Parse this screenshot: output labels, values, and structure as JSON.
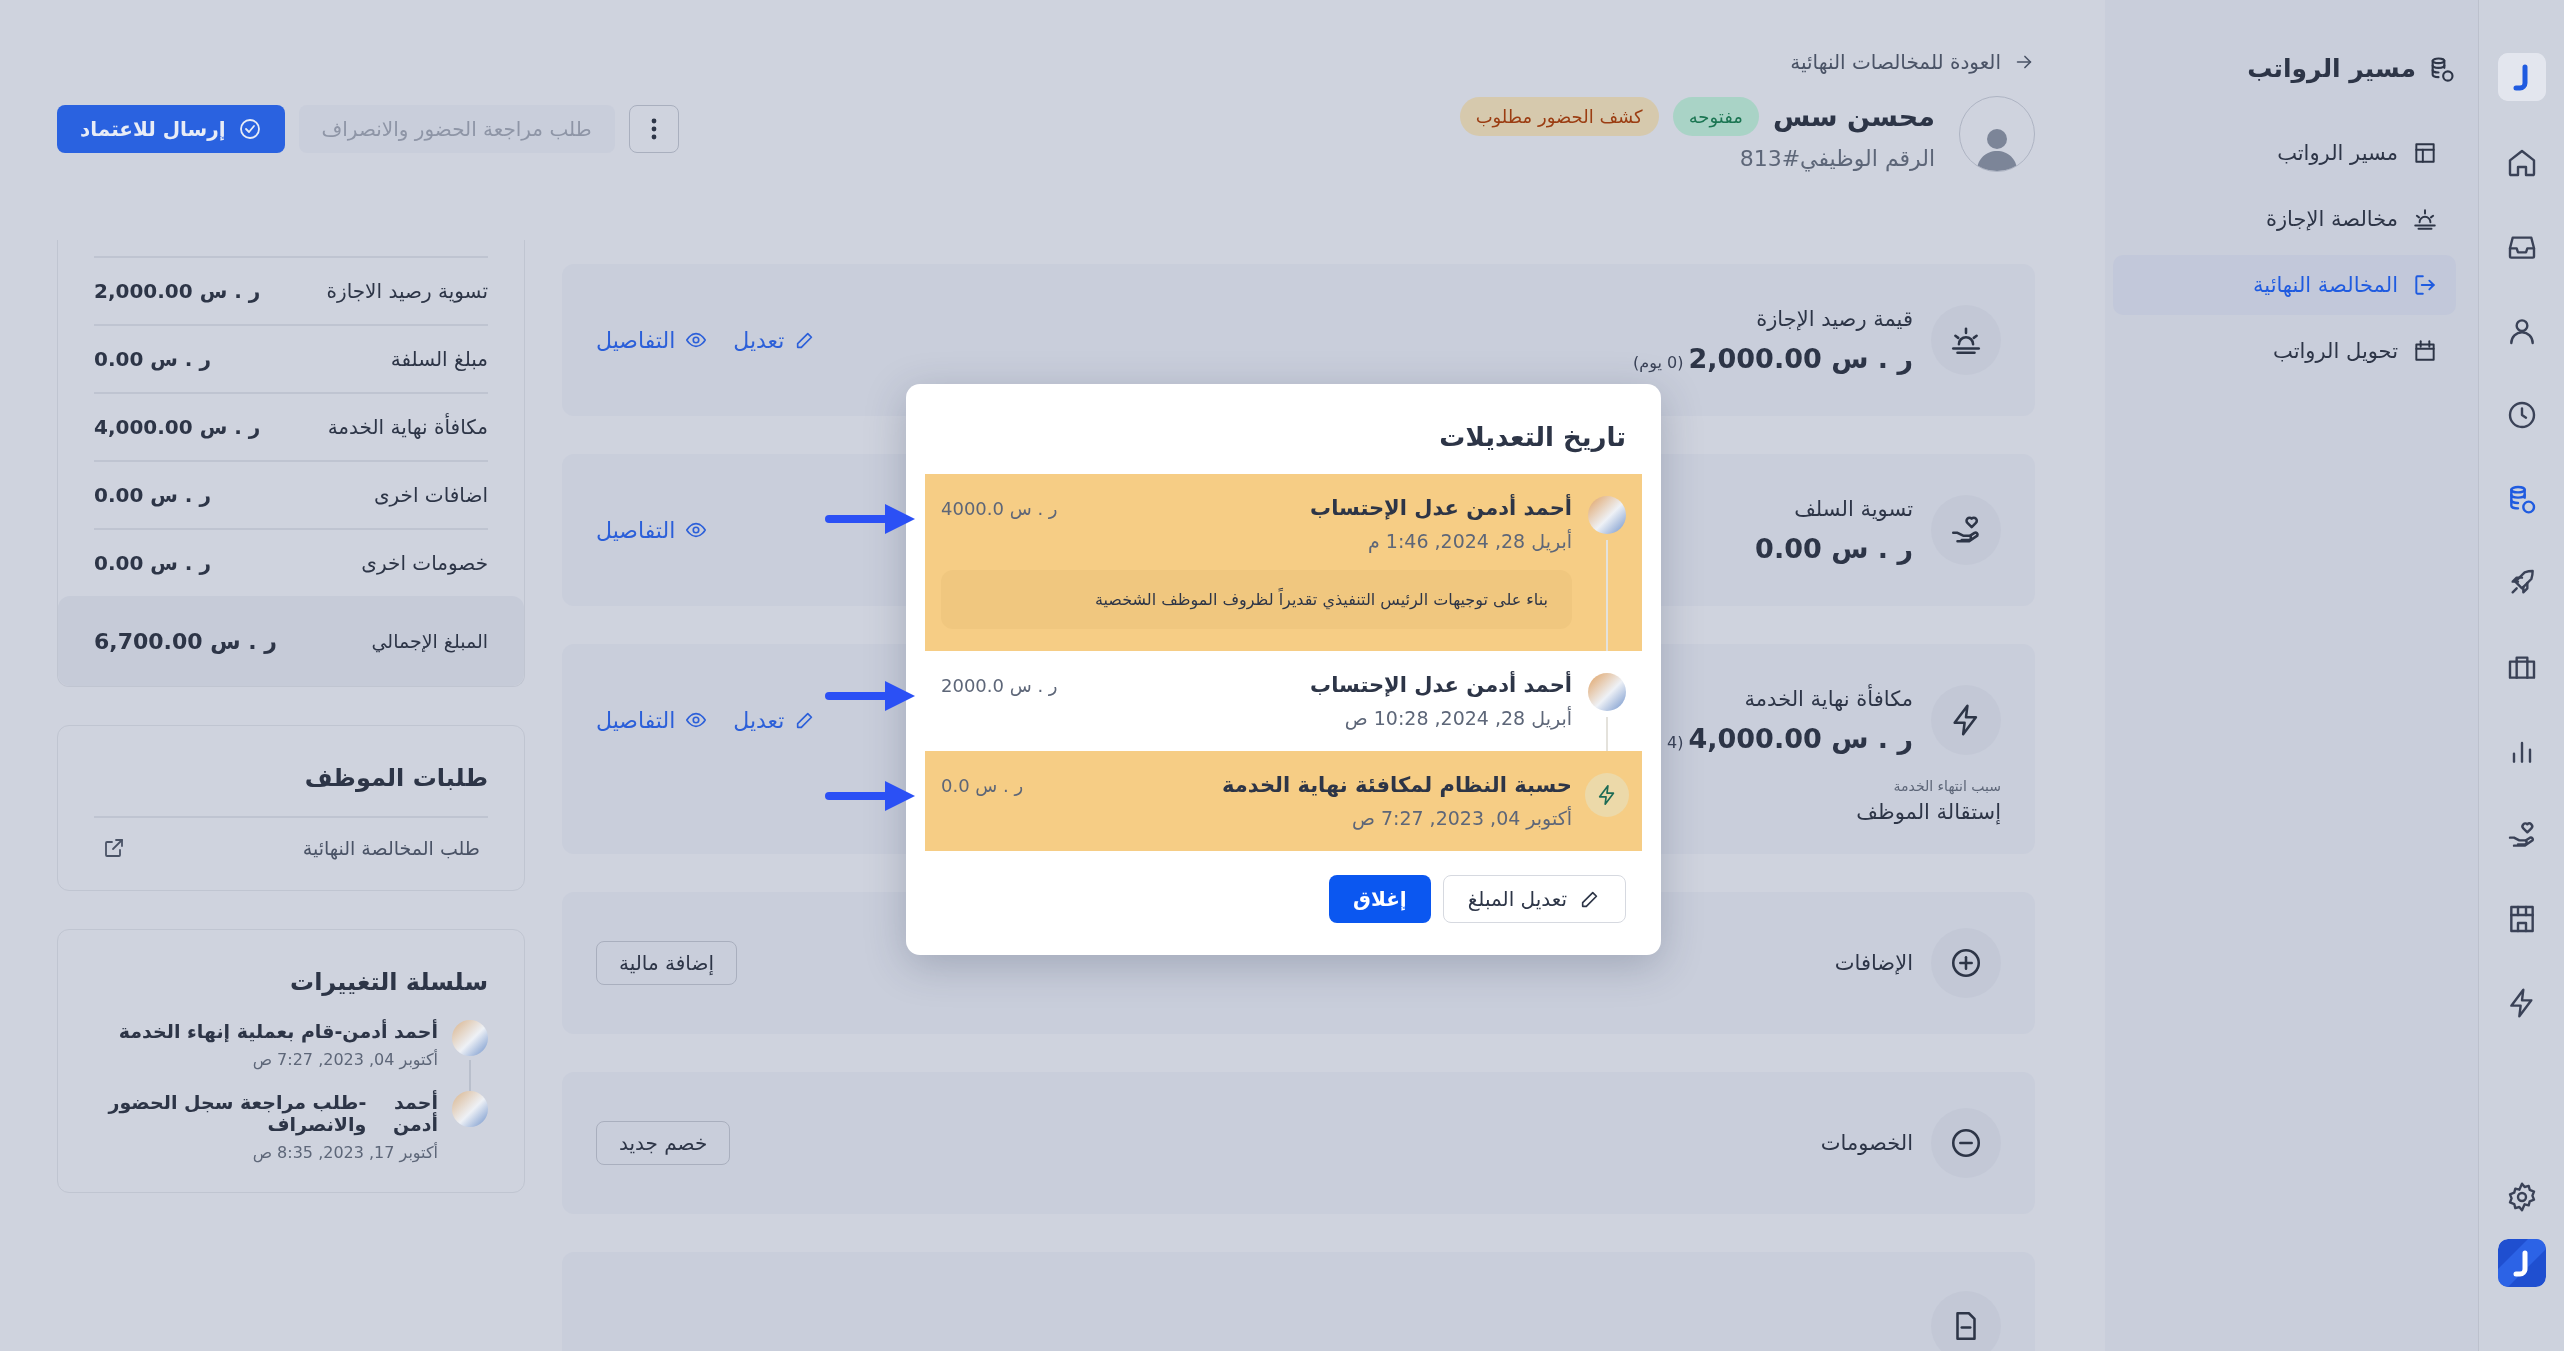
{
  "rail": {
    "items": [
      {
        "selected": false
      },
      {
        "selected": false
      },
      {
        "selected": false
      },
      {
        "selected": false
      },
      {
        "selected": true
      },
      {
        "selected": false
      },
      {
        "selected": false
      },
      {
        "selected": false
      },
      {
        "selected": false
      },
      {
        "selected": false
      },
      {
        "selected": false
      }
    ]
  },
  "sidebar": {
    "title": "مسير الرواتب",
    "items": [
      {
        "label": "مسير الرواتب",
        "selected": false
      },
      {
        "label": "مخالصة الإجازة",
        "selected": false
      },
      {
        "label": "المخالصة النهائية",
        "selected": true
      },
      {
        "label": "تحويل الرواتب",
        "selected": false
      }
    ]
  },
  "header": {
    "back_link": "العودة للمخالصات النهائية",
    "employee_name": "محسن سس",
    "badges": [
      {
        "label": "مفتوحه",
        "kind": "success"
      },
      {
        "label": "كشف الحضور مطلوب",
        "kind": "warning"
      }
    ],
    "employee_number": "الرقم الوظيفي#813"
  },
  "actions": [
    {
      "kind": "more",
      "disabled": false
    },
    {
      "kind": "secondary",
      "label": "طلب مراجعة الحضور والانصراف",
      "disabled": true
    },
    {
      "kind": "primary",
      "label": "إرسال للاعتماد",
      "disabled": false
    }
  ],
  "cards": [
    {
      "kind": "amount",
      "title": "قيمة رصيد الإجازة",
      "amount": "2,000.00 ر . س",
      "amount_note": "(0 يوم)",
      "links": [
        {
          "kind": "edit",
          "label": "تعديل"
        },
        {
          "kind": "details",
          "label": "التفاصيل"
        }
      ]
    },
    {
      "kind": "amount",
      "title": "تسوية السلف",
      "amount": "0.00 ر . س",
      "links": [
        {
          "kind": "details",
          "label": "التفاصيل"
        }
      ]
    },
    {
      "kind": "amount",
      "title": "مكافأة نهاية الخدمة",
      "amount": "4,000.00 ر . س",
      "amount_note": "(4",
      "reason_label": "سبب انتهاء الخدمة",
      "reason": "إستقالة الموظف",
      "links": [
        {
          "kind": "edit",
          "label": "تعديل"
        },
        {
          "kind": "details",
          "label": "التفاصيل"
        }
      ]
    },
    {
      "kind": "section",
      "title": "الإضافات",
      "button": "إضافة مالية"
    },
    {
      "kind": "section",
      "title": "الخصومات",
      "button": "خصم جديد"
    },
    {
      "kind": "cut"
    }
  ],
  "summary": {
    "rows": [
      {
        "label": "تسوية رصيد الاجازة",
        "value": "2,000.00 ر . س"
      },
      {
        "label": "مبلغ السلفة",
        "value": "0.00 ر . س"
      },
      {
        "label": "مكافأة نهاية الخدمة",
        "value": "4,000.00 ر . س"
      },
      {
        "label": "اضافات اخرى",
        "value": "0.00 ر . س"
      },
      {
        "label": "خصومات اخرى",
        "value": "0.00 ر . س"
      }
    ],
    "total": {
      "label": "المبلغ الإجمالي",
      "value": "6,700.00 ر . س"
    }
  },
  "employee_requests": {
    "title": "طلبات الموظف",
    "items": [
      {
        "label": "طلب المخالصة النهائية"
      }
    ]
  },
  "change_log": {
    "title": "سلسلة التغييرات",
    "items": [
      {
        "actor": "أحمد أدمن",
        "action": "-قام بعملية إنهاء الخدمة",
        "time": "أكتوبر 04, 2023, 7:27 ص"
      },
      {
        "actor": "أحمد أدمن",
        "action": "-طلب مراجعة سجل الحضور والانصراف",
        "time": "أكتوبر 17, 2023, 8:35 ص"
      }
    ]
  },
  "dialog": {
    "title": "تاريخ التعديلات",
    "entries": [
      {
        "kind": "user",
        "title": "أحمد أدمن عدل الإحتساب",
        "time": "أبريل 28, 2024, 1:46 م",
        "amount": "4000.0 ر . س",
        "note": "بناء على توجيهات الرئيس التنفيذي تقديراً لظروف الموظف الشخصية",
        "highlighted": true,
        "arrow": true
      },
      {
        "kind": "user",
        "title": "أحمد أدمن عدل الإحتساب",
        "time": "أبريل 28, 2024, 10:28 ص",
        "amount": "2000.0 ر . س",
        "highlighted": false,
        "arrow": true
      },
      {
        "kind": "system",
        "title": "حسبة النظام لمكافئة نهاية الخدمة",
        "time": "أكتوبر 04, 2023, 7:27 ص",
        "amount": "0.0 ر . س",
        "highlighted": true,
        "arrow": true
      }
    ],
    "buttons": [
      {
        "kind": "edit",
        "label": "تعديل المبلغ"
      },
      {
        "kind": "primary",
        "label": "إغلاق"
      }
    ]
  }
}
